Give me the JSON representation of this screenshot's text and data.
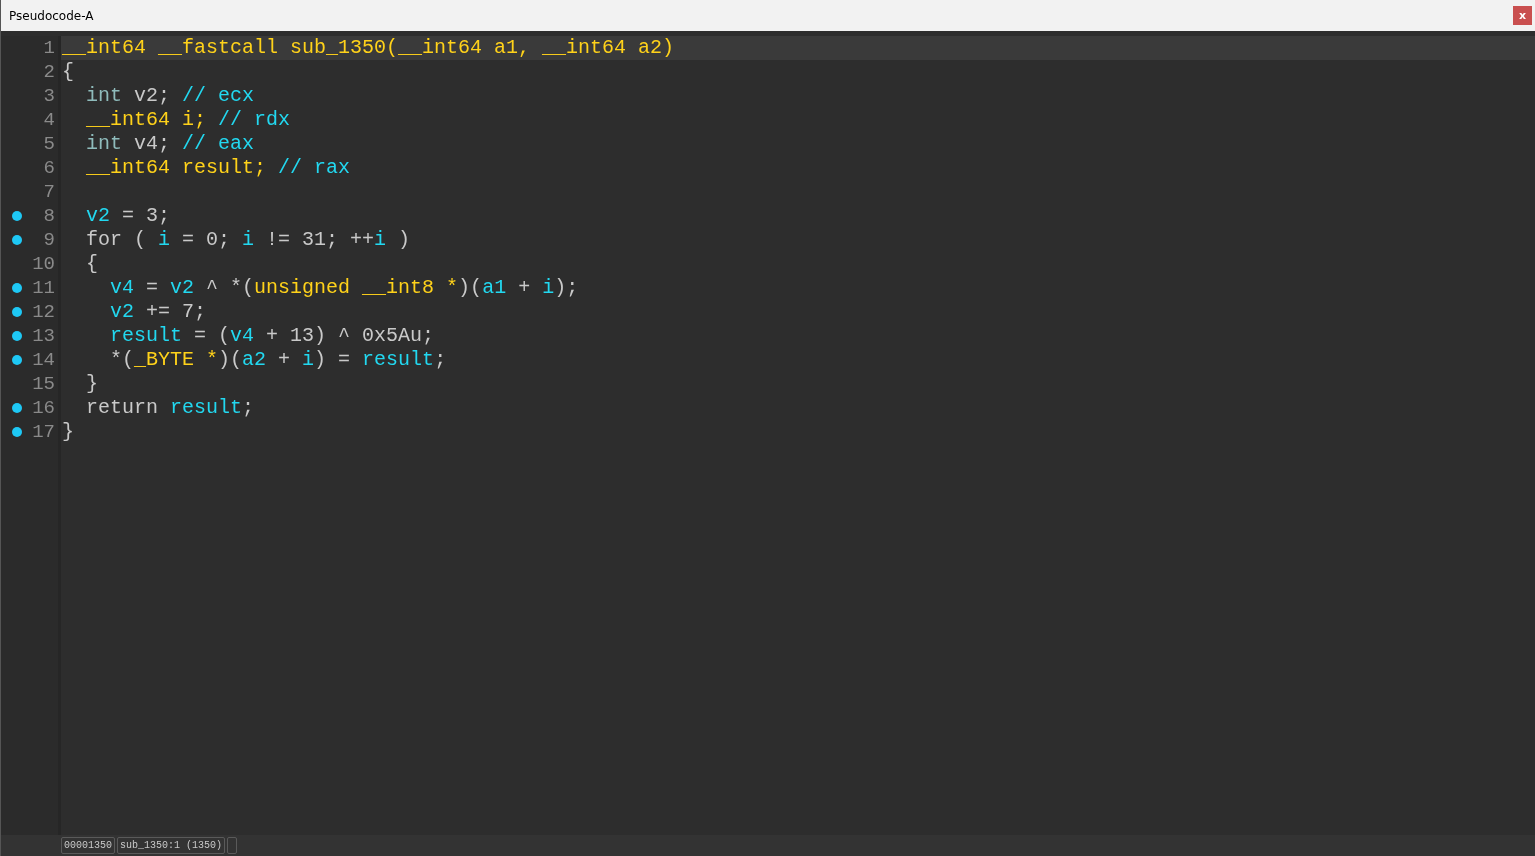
{
  "window": {
    "title": "Pseudocode-A",
    "close": "x"
  },
  "lines": [
    {
      "number": "1",
      "breakpoint": false,
      "current": true,
      "tokens": [
        {
          "kind": "type",
          "text": "__int64 __fastcall sub_1350(__int64 a1, __int64 a2)"
        }
      ]
    },
    {
      "number": "2",
      "breakpoint": false,
      "current": false,
      "tokens": [
        {
          "kind": "plain",
          "text": "{"
        }
      ]
    },
    {
      "number": "3",
      "breakpoint": false,
      "current": false,
      "tokens": [
        {
          "kind": "kw",
          "text": "  int "
        },
        {
          "kind": "plain",
          "text": "v2; "
        },
        {
          "kind": "ident",
          "text": "// ecx"
        }
      ]
    },
    {
      "number": "4",
      "breakpoint": false,
      "current": false,
      "tokens": [
        {
          "kind": "type",
          "text": "  __int64 i; "
        },
        {
          "kind": "ident",
          "text": "// rdx"
        }
      ]
    },
    {
      "number": "5",
      "breakpoint": false,
      "current": false,
      "tokens": [
        {
          "kind": "kw",
          "text": "  int "
        },
        {
          "kind": "plain",
          "text": "v4; "
        },
        {
          "kind": "ident",
          "text": "// eax"
        }
      ]
    },
    {
      "number": "6",
      "breakpoint": false,
      "current": false,
      "tokens": [
        {
          "kind": "type",
          "text": "  __int64 result; "
        },
        {
          "kind": "ident",
          "text": "// rax"
        }
      ]
    },
    {
      "number": "7",
      "breakpoint": false,
      "current": false
    },
    {
      "number": "8",
      "breakpoint": true,
      "current": false,
      "tokens": [
        {
          "kind": "ident",
          "text": "  v2"
        },
        {
          "kind": "plain",
          "text": " = 3;"
        }
      ]
    },
    {
      "number": "9",
      "breakpoint": true,
      "current": false,
      "tokens": [
        {
          "kind": "plain",
          "text": "  for ( "
        },
        {
          "kind": "ident",
          "text": "i"
        },
        {
          "kind": "plain",
          "text": " = 0; "
        },
        {
          "kind": "ident",
          "text": "i"
        },
        {
          "kind": "plain",
          "text": " != 31; ++"
        },
        {
          "kind": "ident",
          "text": "i"
        },
        {
          "kind": "plain",
          "text": " )"
        }
      ]
    },
    {
      "number": "10",
      "breakpoint": false,
      "current": false,
      "tokens": [
        {
          "kind": "plain",
          "text": "  {"
        }
      ]
    },
    {
      "number": "11",
      "breakpoint": true,
      "current": false,
      "tokens": [
        {
          "kind": "ident",
          "text": "    v4"
        },
        {
          "kind": "plain",
          "text": " = "
        },
        {
          "kind": "ident",
          "text": "v2"
        },
        {
          "kind": "plain",
          "text": " ^ *("
        },
        {
          "kind": "type",
          "text": "unsigned __int8 *"
        },
        {
          "kind": "plain",
          "text": ")("
        },
        {
          "kind": "ident",
          "text": "a1"
        },
        {
          "kind": "plain",
          "text": " + "
        },
        {
          "kind": "ident",
          "text": "i"
        },
        {
          "kind": "plain",
          "text": ");"
        }
      ]
    },
    {
      "number": "12",
      "breakpoint": true,
      "current": false,
      "tokens": [
        {
          "kind": "ident",
          "text": "    v2"
        },
        {
          "kind": "plain",
          "text": " += 7;"
        }
      ]
    },
    {
      "number": "13",
      "breakpoint": true,
      "current": false,
      "tokens": [
        {
          "kind": "ident",
          "text": "    result"
        },
        {
          "kind": "plain",
          "text": " = ("
        },
        {
          "kind": "ident",
          "text": "v4"
        },
        {
          "kind": "plain",
          "text": " + 13) ^ 0x5Au;"
        }
      ]
    },
    {
      "number": "14",
      "breakpoint": true,
      "current": false,
      "tokens": [
        {
          "kind": "plain",
          "text": "    *("
        },
        {
          "kind": "type",
          "text": "_BYTE *"
        },
        {
          "kind": "plain",
          "text": ")("
        },
        {
          "kind": "ident",
          "text": "a2"
        },
        {
          "kind": "plain",
          "text": " + "
        },
        {
          "kind": "ident",
          "text": "i"
        },
        {
          "kind": "plain",
          "text": ") = "
        },
        {
          "kind": "ident",
          "text": "result"
        },
        {
          "kind": "plain",
          "text": ";"
        }
      ]
    },
    {
      "number": "15",
      "breakpoint": false,
      "current": false,
      "tokens": [
        {
          "kind": "plain",
          "text": "  }"
        }
      ]
    },
    {
      "number": "16",
      "breakpoint": true,
      "current": false,
      "tokens": [
        {
          "kind": "plain",
          "text": "  return "
        },
        {
          "kind": "ident",
          "text": "result"
        },
        {
          "kind": "plain",
          "text": ";"
        }
      ]
    },
    {
      "number": "17",
      "breakpoint": true,
      "current": false,
      "tokens": [
        {
          "kind": "plain",
          "text": "}"
        }
      ]
    }
  ],
  "status_bar": [
    "00001350",
    "sub_1350:1 (1350)"
  ]
}
